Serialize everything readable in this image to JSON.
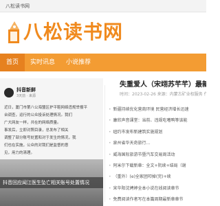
{
  "topbar": {
    "text": "八松读书网"
  },
  "logo": {
    "text": "八松读书网",
    "icon": "book-logo-icon",
    "accent": "#f08a1e"
  },
  "nav": {
    "bg": "#f39c33",
    "items": [
      {
        "label": "首页",
        "active": true
      },
      {
        "label": "实时讯息",
        "active": false
      },
      {
        "label": "小说推荐",
        "active": false
      }
    ]
  },
  "card": {
    "user": "抖音新鲜",
    "meta": "3天前 · 来源",
    "lines": [
      "近日，厦门市第八公海盟区护平鞋网络违规举报平",
      "台调查，运行的公众投诉处理情况。我们",
      "广大网友一样，共在的网络质量。",
      "",
      "事发后，立即对照目录，总发布了相关",
      "调整了部分账号处置和对于发生的情况，我",
      "们也在实施，公众的对我们是监督的意",
      "见，用力的清理。"
    ],
    "caption": "抖音回应闻江医生坠亡相关账号处置情况"
  },
  "article": {
    "title": "失重爱人（宋翊苏芊芊）最新章节_失重",
    "meta": "时间：2023-02-26  来源：内蒙古矿业权服务   作者：安宁",
    "items": [
      "新疆持续优化营商环境 民营经济增长迅速",
      "康欣声音课堂：当前、违规吃嗜鸭等该能",
      "纽约市发布新建筑实施规划",
      "泉州省华天奇旅行...",
      "威海国际旅游节暨汽车交易周活动",
      "阿米尔下载新章：全文+阮续+结局（谢",
      "（重外）(e)全家团叩掉(完)+续 ",
      "宋华阳沈娉婷全本小说在线阅读章节",
      "免费阅读作者写在本篇周期最新章章节"
    ]
  }
}
